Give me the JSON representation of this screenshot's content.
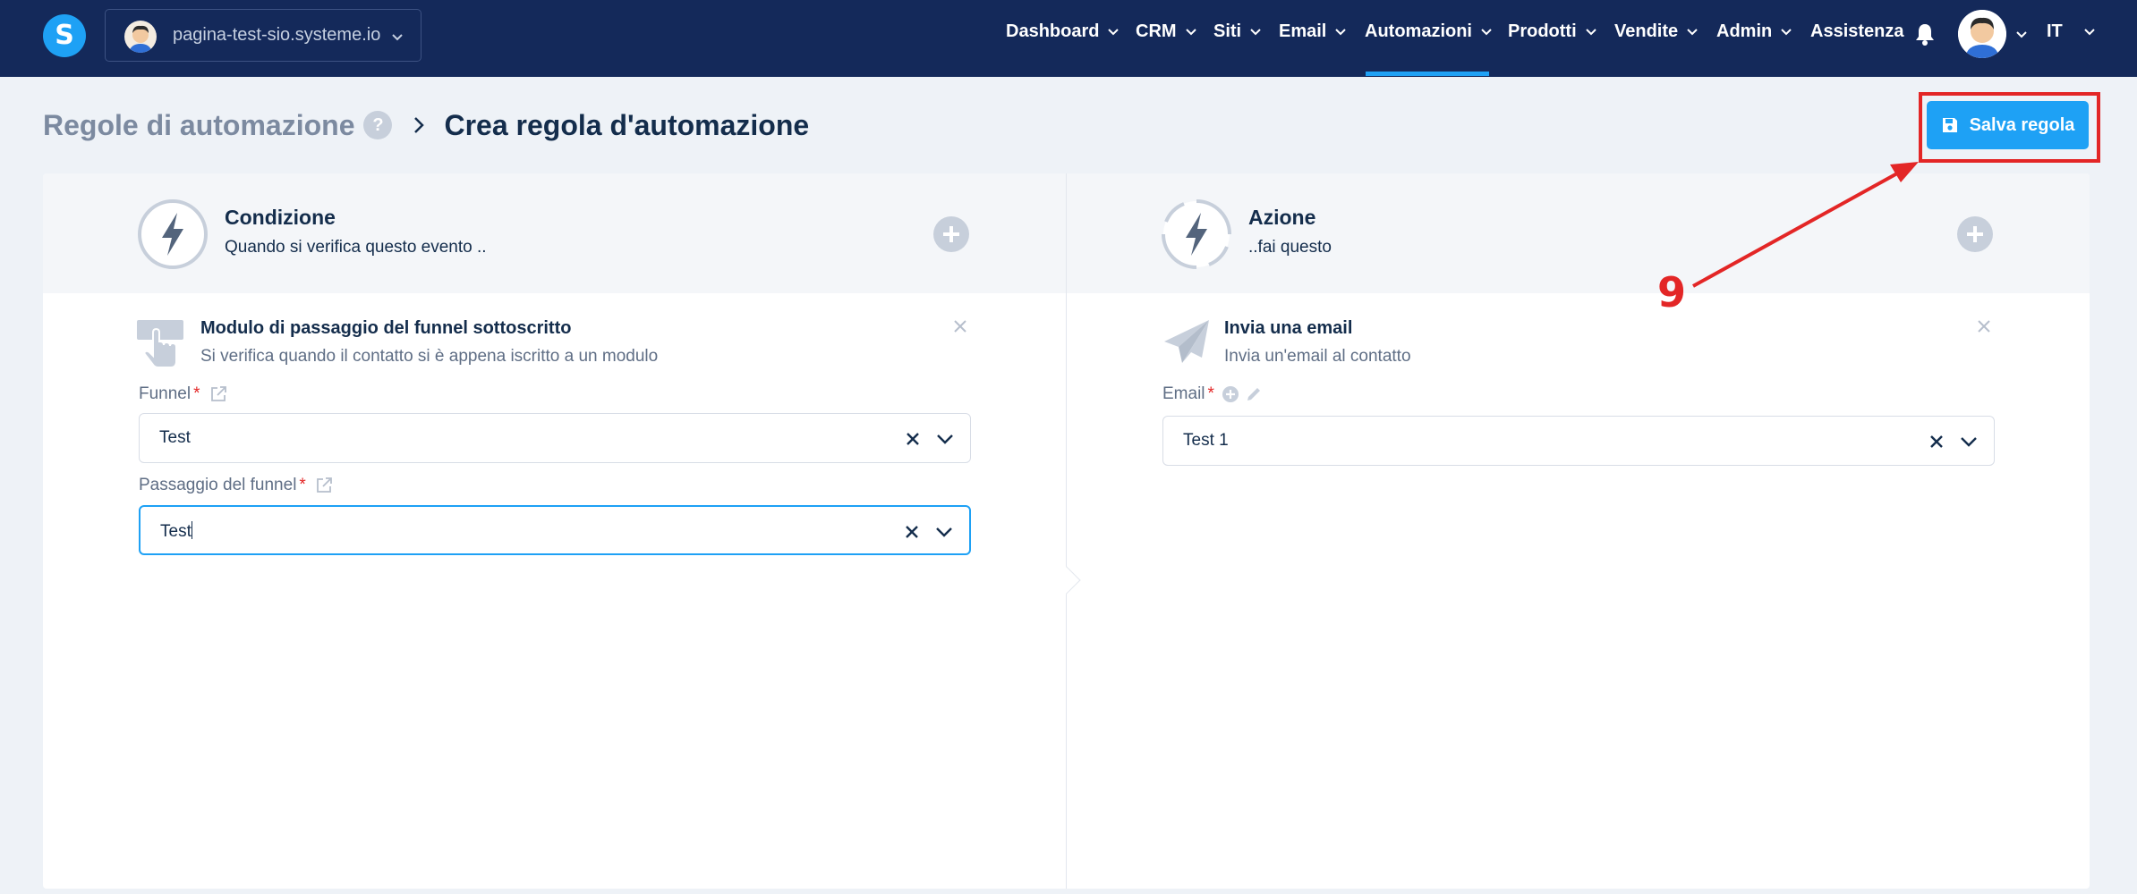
{
  "nav": {
    "site_url": "pagina-test-sio.systeme.io",
    "items": [
      {
        "label": "Dashboard"
      },
      {
        "label": "CRM"
      },
      {
        "label": "Siti"
      },
      {
        "label": "Email"
      },
      {
        "label": "Automazioni"
      },
      {
        "label": "Prodotti"
      },
      {
        "label": "Vendite"
      },
      {
        "label": "Admin"
      },
      {
        "label": "Assistenza"
      }
    ],
    "active": "Automazioni",
    "language": "IT",
    "colors": {
      "background": "#14295a",
      "accent": "#1ea1f5"
    }
  },
  "header": {
    "breadcrumb_parent": "Regole di automazione",
    "help_label": "?",
    "breadcrumb_current": "Crea regola d'automazione",
    "save_label": "Salva regola"
  },
  "annotation": {
    "step_number": "9",
    "color": "#e32626"
  },
  "condition": {
    "title": "Condizione",
    "subtitle": "Quando si verifica questo evento ..",
    "trigger_title": "Modulo di passaggio del funnel sottoscritto",
    "trigger_description": "Si verifica quando il contatto si è appena iscritto a un modulo",
    "fields": [
      {
        "label": "Funnel",
        "required_mark": "*",
        "value": "Test"
      },
      {
        "label": "Passaggio del funnel",
        "required_mark": "*",
        "value": "Test"
      }
    ]
  },
  "action": {
    "title": "Azione",
    "subtitle": "..fai questo",
    "action_title": "Invia una email",
    "action_description": "Invia un'email al contatto",
    "fields": [
      {
        "label": "Email",
        "required_mark": "*",
        "value": "Test 1"
      }
    ]
  }
}
